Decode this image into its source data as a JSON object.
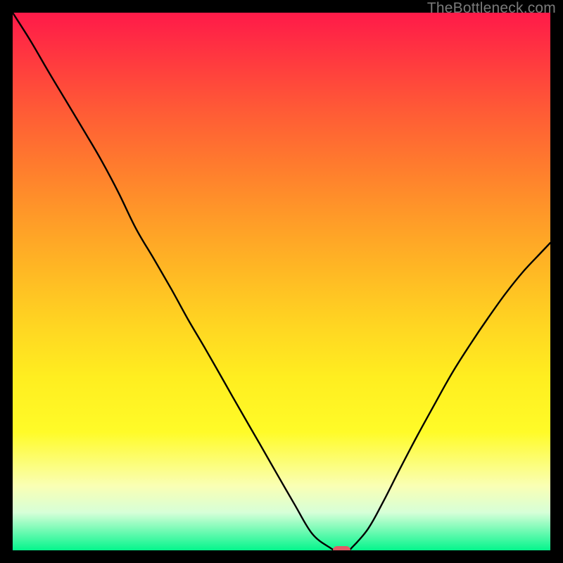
{
  "watermark": "TheBottleneck.com",
  "colors": {
    "background": "#000000",
    "curve": "#000000",
    "marker": "#e15a66",
    "watermark": "#7a7a7a"
  },
  "chart_data": {
    "type": "line",
    "title": "",
    "xlabel": "",
    "ylabel": "",
    "xlim": [
      0,
      100
    ],
    "ylim": [
      0,
      100
    ],
    "x": [
      0,
      3.3,
      6.5,
      9.8,
      13.1,
      16.4,
      19.6,
      22.9,
      26.2,
      29.5,
      32.7,
      36.0,
      39.3,
      42.6,
      45.9,
      49.1,
      52.4,
      55.7,
      59.0,
      60.2,
      62.3,
      63.0,
      66.1,
      69.0,
      72.0,
      75.3,
      78.6,
      81.8,
      85.1,
      88.4,
      91.7,
      95.0,
      98.2,
      100.0
    ],
    "values": [
      100.0,
      94.8,
      89.3,
      83.8,
      78.3,
      72.7,
      66.7,
      59.9,
      54.3,
      48.6,
      42.8,
      37.2,
      31.4,
      25.6,
      19.9,
      14.3,
      8.6,
      3.1,
      0.5,
      0.0,
      0.0,
      0.4,
      4.0,
      9.2,
      15.1,
      21.4,
      27.4,
      33.1,
      38.3,
      43.2,
      47.8,
      51.9,
      55.3,
      57.2
    ],
    "marker": {
      "x": 61.2,
      "y": 0.0,
      "width_pct": 3.2,
      "height_pct": 1.6
    }
  }
}
